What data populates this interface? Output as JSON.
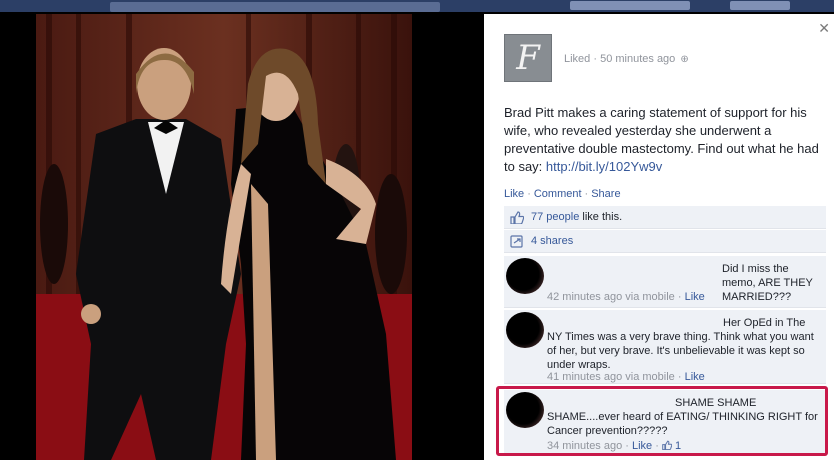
{
  "page": {
    "liked_text": "Liked",
    "liked_time": "50 minutes ago",
    "logo_glyph": "F"
  },
  "status": {
    "text": "Brad Pitt makes a caring statement of support for his wife, who revealed yesterday she underwent a preventative double mastectomy. Find out what he had to say: ",
    "link": "http://bit.ly/102Yw9v"
  },
  "actions": {
    "like": "Like",
    "comment": "Comment",
    "share": "Share"
  },
  "feedback": {
    "likes_link": "77 people",
    "likes_suffix": "like this.",
    "shares": "4 shares"
  },
  "comments": [
    {
      "text": "Did I miss the memo, ARE THEY MARRIED???",
      "time": "42 minutes ago via mobile",
      "like": "Like"
    },
    {
      "text": "Her OpEd in The NY Times was a very brave thing. Think what you want of her, but very brave. It's unbelievable it was kept so under wraps.",
      "time": "41 minutes ago via mobile",
      "like": "Like"
    },
    {
      "text": "SHAME SHAME SHAME....ever heard of EATING/ THINKING RIGHT for Cancer prevention?????",
      "time": "34 minutes ago",
      "like": "Like",
      "like_count": "1"
    }
  ],
  "colors": {
    "link": "#365899",
    "highlight_border": "#c8194a",
    "panel_bg": "#ffffff",
    "feedback_bg": "#eef1f6"
  }
}
